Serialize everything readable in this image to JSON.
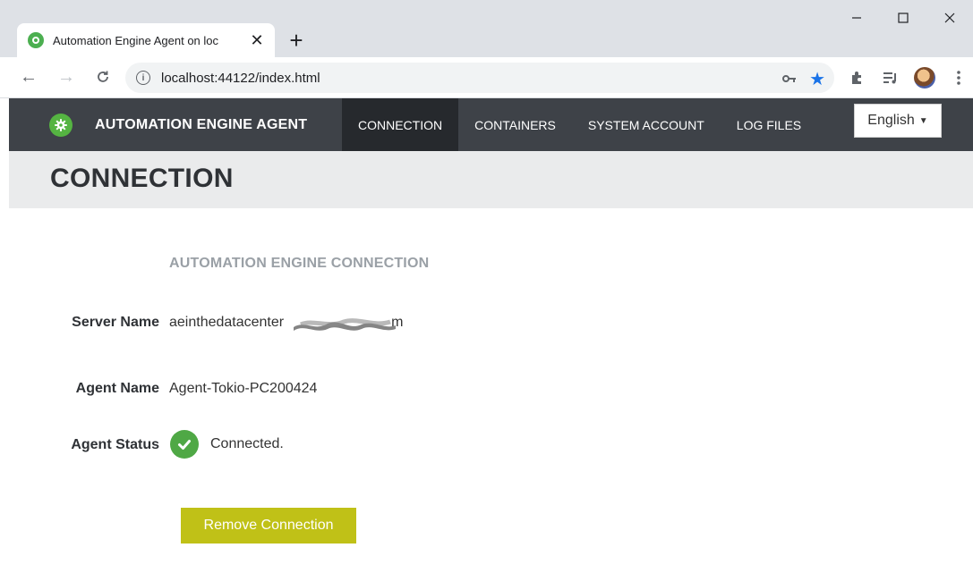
{
  "browser": {
    "tab_title": "Automation Engine Agent on loc",
    "url": "localhost:44122/index.html"
  },
  "navbar": {
    "brand": "AUTOMATION ENGINE AGENT",
    "menu": [
      "CONNECTION",
      "CONTAINERS",
      "SYSTEM ACCOUNT",
      "LOG FILES"
    ],
    "active_menu": "CONNECTION",
    "language": "English"
  },
  "page": {
    "title": "CONNECTION"
  },
  "connection": {
    "section_title": "AUTOMATION ENGINE CONNECTION",
    "server_name_label": "Server Name",
    "server_name_prefix": "aeinthedatacenter",
    "server_name_suffix": "m",
    "agent_name_label": "Agent Name",
    "agent_name": "Agent-Tokio-PC200424",
    "agent_status_label": "Agent Status",
    "agent_status": "Connected.",
    "remove_button": "Remove Connection"
  },
  "colors": {
    "navbar": "#3e4248",
    "brand_green": "#55b442",
    "status_green": "#4fa845",
    "button_olive": "#c0c117"
  },
  "icons": {
    "brand": "gear-icon",
    "status": "check-circle-icon"
  }
}
